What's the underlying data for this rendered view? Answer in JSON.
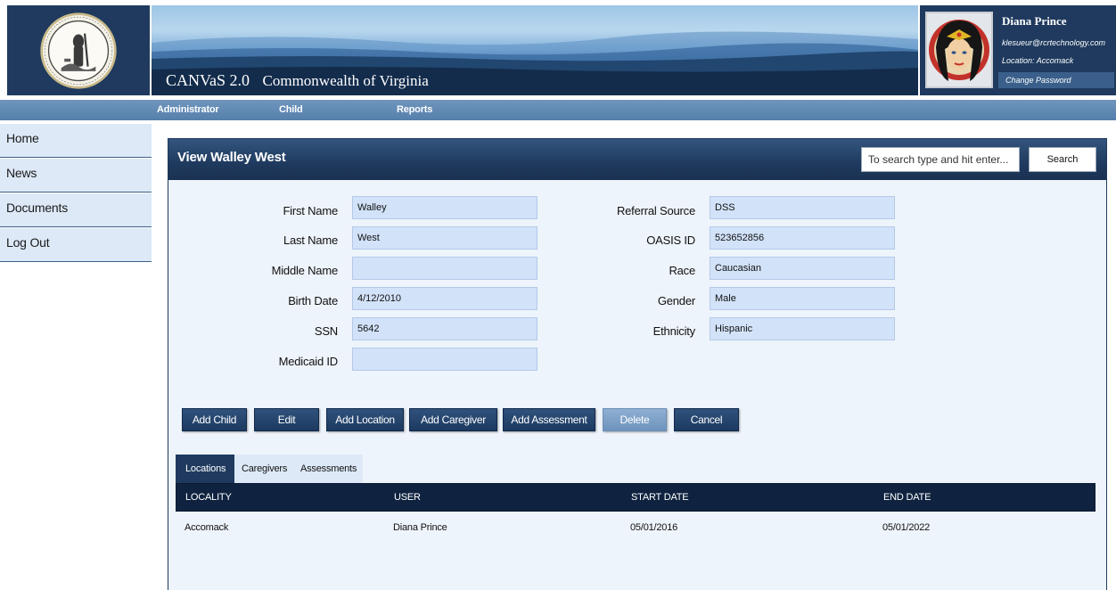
{
  "header": {
    "app_name": "CANVaS 2.0",
    "app_subtitle": "Commonwealth of Virginia"
  },
  "user": {
    "name": "Diana Prince",
    "email": "klesueur@rcrtechnology.com",
    "location": "Location: Accomack",
    "change_password": "Change Password"
  },
  "nav": {
    "items": [
      {
        "label": "Administrator"
      },
      {
        "label": "Child"
      },
      {
        "label": "Reports"
      }
    ]
  },
  "sidebar": {
    "items": [
      {
        "label": "Home"
      },
      {
        "label": "News"
      },
      {
        "label": "Documents"
      },
      {
        "label": "Log Out"
      }
    ]
  },
  "panel": {
    "title": "View Walley West",
    "search_placeholder": "To search type and hit enter...",
    "search_label": "Search"
  },
  "form": {
    "left": [
      {
        "label": "First Name",
        "value": "Walley"
      },
      {
        "label": "Last Name",
        "value": "West"
      },
      {
        "label": "Middle Name",
        "value": ""
      },
      {
        "label": "Birth Date",
        "value": "4/12/2010"
      },
      {
        "label": "SSN",
        "value": "5642"
      },
      {
        "label": "Medicaid ID",
        "value": ""
      }
    ],
    "right": [
      {
        "label": "Referral Source",
        "value": "DSS"
      },
      {
        "label": "OASIS ID",
        "value": "523652856"
      },
      {
        "label": "Race",
        "value": "Caucasian"
      },
      {
        "label": "Gender",
        "value": "Male"
      },
      {
        "label": "Ethnicity",
        "value": "Hispanic"
      }
    ]
  },
  "actions": [
    {
      "label": "Add Child"
    },
    {
      "label": "Edit"
    },
    {
      "label": "Add Location"
    },
    {
      "label": "Add Caregiver"
    },
    {
      "label": "Add Assessment"
    },
    {
      "label": "Delete"
    },
    {
      "label": "Cancel"
    }
  ],
  "tabs": [
    {
      "label": "Locations",
      "active": true
    },
    {
      "label": "Caregivers",
      "active": false
    },
    {
      "label": "Assessments",
      "active": false
    }
  ],
  "grid": {
    "columns": [
      "LOCALITY",
      "USER",
      "START DATE",
      "END DATE"
    ],
    "rows": [
      [
        "Accomack",
        "Diana Prince",
        "05/01/2016",
        "05/01/2022"
      ]
    ]
  },
  "colors": {
    "header_navy": "#1f3a5e",
    "nav_blue": "#5a83ae",
    "field_fill": "#d2e2f9",
    "sidebar_fill": "#dde9f7"
  }
}
